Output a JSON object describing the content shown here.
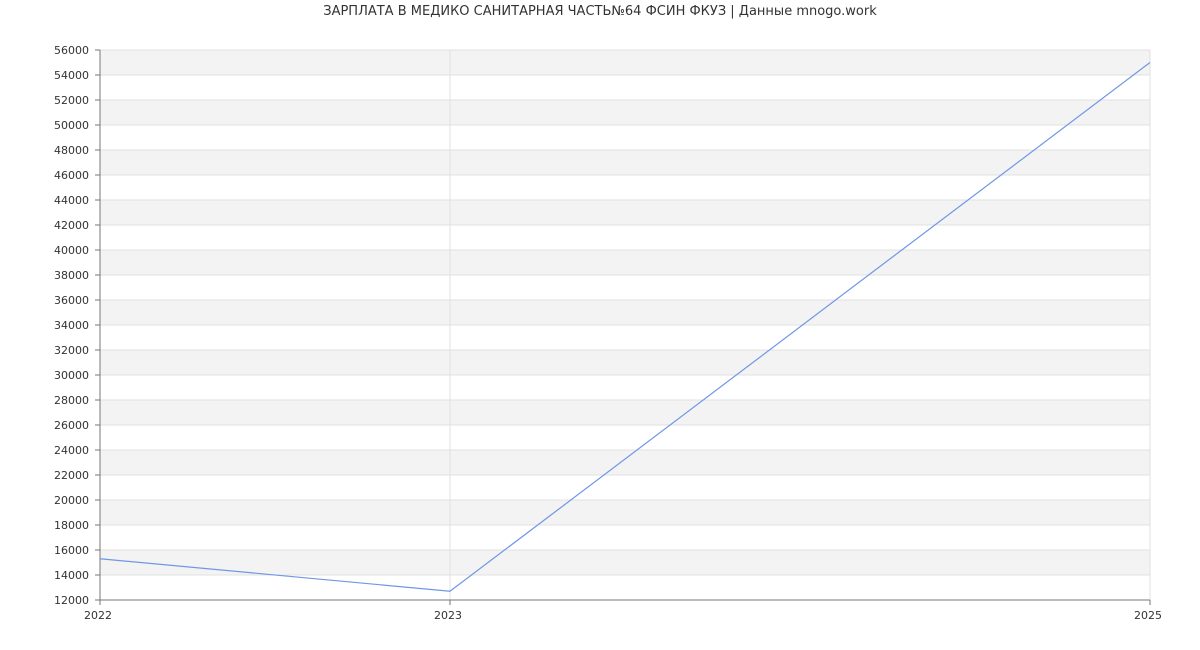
{
  "chart_data": {
    "type": "line",
    "title": "ЗАРПЛАТА В МЕДИКО САНИТАРНАЯ ЧАСТЬ№64 ФСИН ФКУЗ | Данные mnogo.work",
    "xlabel": "",
    "ylabel": "",
    "x": [
      2022,
      2023,
      2025
    ],
    "x_tick_labels": [
      "2022",
      "2023",
      "2025"
    ],
    "series": [
      {
        "values": [
          15300,
          12700,
          55000
        ],
        "color": "#6f97e6"
      }
    ],
    "ylim": [
      12000,
      56000
    ],
    "y_tick_step": 2000,
    "grid": true,
    "band_colors": [
      "#f3f3f3",
      "#ffffff"
    ],
    "gridline_color": "#e0e0e0",
    "axis_color": "#777777"
  }
}
